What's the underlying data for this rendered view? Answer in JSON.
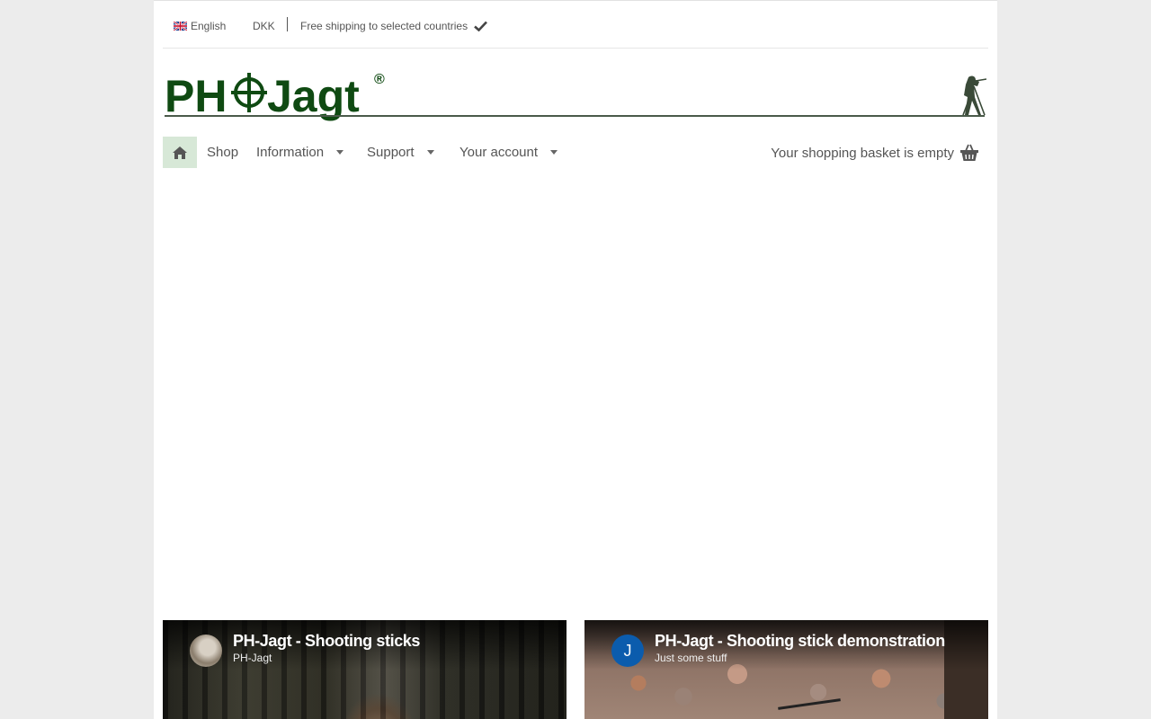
{
  "topbar": {
    "language": "English",
    "currency": "DKK",
    "shipping": "Free shipping to selected countries"
  },
  "logo": {
    "text": "PH-Jagt",
    "registered": "®"
  },
  "nav": {
    "items": [
      {
        "label": "Shop"
      },
      {
        "label": "Information"
      },
      {
        "label": "Support"
      },
      {
        "label": "Your account"
      }
    ],
    "basket": "Your shopping basket is empty"
  },
  "videos": [
    {
      "title": "PH-Jagt - Shooting sticks",
      "channel": "PH-Jagt",
      "avatar": ""
    },
    {
      "title": "PH-Jagt - Shooting stick demonstration",
      "channel": "Just some stuff",
      "avatar": "J"
    }
  ],
  "colors": {
    "brand_green": "#0f4a12",
    "home_bg": "#d7e8d7",
    "page_bg": "#ececec"
  }
}
